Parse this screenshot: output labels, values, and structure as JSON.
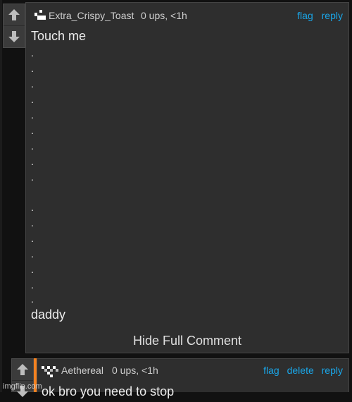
{
  "comment1": {
    "username": "Extra_Crispy_Toast",
    "meta": "0 ups, <1h",
    "actions": {
      "flag": "flag",
      "reply": "reply"
    },
    "body_first": "Touch me",
    "dots": [
      ".",
      ".",
      ".",
      ".",
      ".",
      ".",
      ".",
      ".",
      ".",
      ".",
      ".",
      ".",
      ".",
      ".",
      ".",
      ".",
      "."
    ],
    "body_last": "daddy",
    "hide_label": "Hide Full Comment"
  },
  "comment2": {
    "username": "Aethereal",
    "meta": "0 ups, <1h",
    "actions": {
      "flag": "flag",
      "delete": "delete",
      "reply": "reply"
    },
    "body": "ok bro you need to stop",
    "accent_color": "#f58220"
  },
  "watermark": "imgflip.com",
  "icons": {
    "upvote": "arrow-up-icon",
    "downvote": "arrow-down-icon"
  },
  "colors": {
    "link": "#1aa6e8",
    "panel": "#2e2e2e"
  }
}
